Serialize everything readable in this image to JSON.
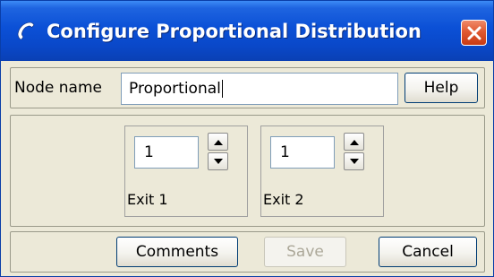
{
  "window": {
    "title": "Configure Proportional Distribution",
    "close_icon": "close-icon",
    "title_icon": "handset-icon"
  },
  "node": {
    "label": "Node name",
    "value": "Proportional",
    "help_label": "Help"
  },
  "exits": [
    {
      "value": "1",
      "label": "Exit 1"
    },
    {
      "value": "1",
      "label": "Exit 2"
    }
  ],
  "footer": {
    "comments_label": "Comments",
    "save_label": "Save",
    "save_enabled": false,
    "cancel_label": "Cancel"
  },
  "colors": {
    "titlebar": "#0a48c9",
    "dialog_bg": "#ece9d8",
    "close_button": "#e05a32"
  }
}
